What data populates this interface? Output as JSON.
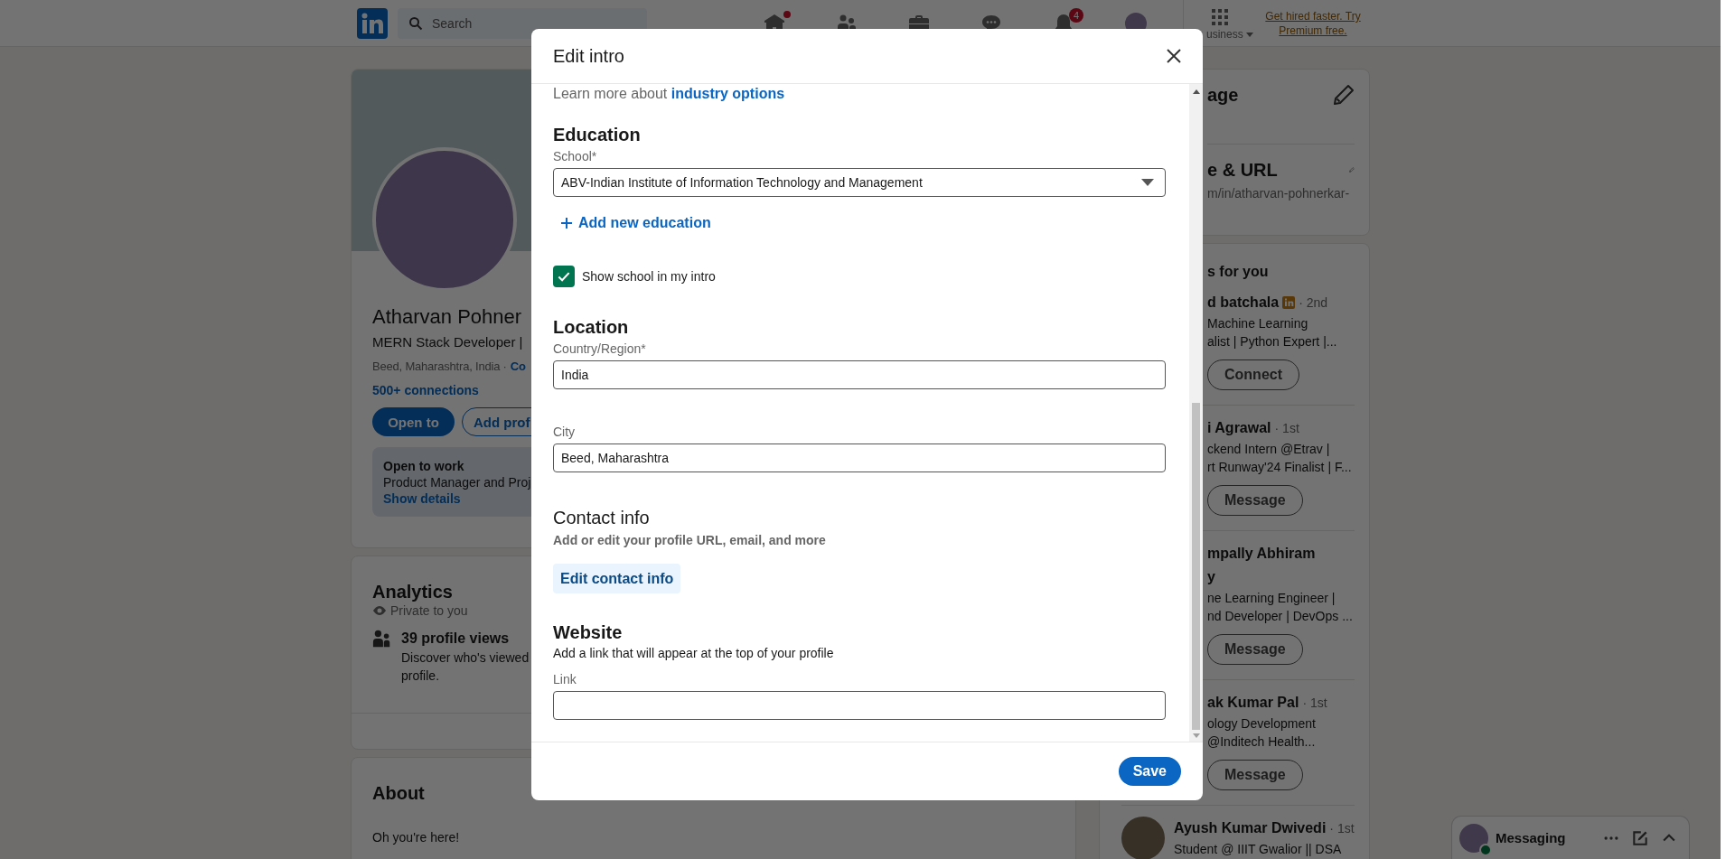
{
  "nav": {
    "search_placeholder": "Search",
    "items": [
      {
        "kind": "home",
        "dot": true
      },
      {
        "kind": "network",
        "dot": false
      },
      {
        "kind": "jobs",
        "dot": false
      },
      {
        "kind": "messaging",
        "dot": false
      },
      {
        "kind": "notifications",
        "dot": false,
        "badge": "4"
      },
      {
        "kind": "me",
        "dot": false
      }
    ],
    "business": "usiness",
    "premium": "Get hired faster. Try Premium free."
  },
  "profile": {
    "name": "Atharvan Pohner",
    "headline": "MERN Stack Developer |",
    "location": "Beed, Maharashtra, India ·",
    "contact_link": "Co",
    "connections": "500+ connections",
    "buttons": [
      {
        "label": "Open to",
        "kind": "primary"
      },
      {
        "label": "Add prof",
        "kind": "outline"
      }
    ],
    "open_to_work": {
      "title": "Open to work",
      "text": "Product Manager and Proj",
      "link": "Show details"
    }
  },
  "analytics": {
    "title": "Analytics",
    "privacy": "Private to you",
    "views": "39 profile views",
    "description_lines": [
      "Discover who's viewed",
      "profile."
    ]
  },
  "about": {
    "title": "About",
    "text": "Oh you're here!"
  },
  "right": {
    "settings": [
      {
        "title": "age"
      },
      {
        "title": "e & URL",
        "subtitle": "m/in/atharvan-pohnerkar-"
      }
    ],
    "suggestions_title": "s for you",
    "people": [
      {
        "name_lines": [
          "d batchala"
        ],
        "premium": true,
        "degree": "· 2nd",
        "lines": [
          "Machine Learning",
          "alist | Python Expert |..."
        ],
        "action": "Connect",
        "avatar": false
      },
      {
        "name_lines": [
          "i Agrawal"
        ],
        "premium": false,
        "degree": "· 1st",
        "lines": [
          "ckend Intern @Etrav |",
          "rt Runway'24 Finalist | F..."
        ],
        "action": "Message",
        "avatar": false
      },
      {
        "name_lines": [
          "mpally Abhiram",
          "y"
        ],
        "premium": false,
        "lines": [
          "ne Learning Engineer |",
          "nd Developer | DevOps ..."
        ],
        "action": "Message",
        "avatar": false
      },
      {
        "name_lines": [
          "ak Kumar Pal"
        ],
        "premium": false,
        "degree": "· 1st",
        "lines": [
          "ology Development",
          "@Inditech Health..."
        ],
        "action": "Message",
        "avatar": false
      },
      {
        "name_lines": [
          "Ayush Kumar Dwivedi"
        ],
        "premium": false,
        "degree": "· 1st",
        "lines": [
          "Student @ IIIT Gwalior || DSA"
        ],
        "avatar": true
      }
    ]
  },
  "messaging": {
    "label": "Messaging",
    "online": true
  },
  "modal": {
    "title": "Edit intro",
    "intro_text": "Learn more about",
    "intro_link": "industry options",
    "education": {
      "heading": "Education",
      "school_label": "School*",
      "school_value": "ABV-Indian Institute of Information Technology and Management",
      "add_link": "Add new education",
      "show_school": {
        "label": "Show school in my intro",
        "checked": true
      }
    },
    "location": {
      "heading": "Location",
      "country_label": "Country/Region*",
      "country_value": "India",
      "city_label": "City",
      "city_value": "Beed, Maharashtra"
    },
    "contact": {
      "heading": "Contact info",
      "description": "Add or edit your profile URL, email, and more",
      "button": "Edit contact info"
    },
    "website": {
      "heading": "Website",
      "description": "Add a link that will appear at the top of your profile",
      "link_label": "Link"
    },
    "save": "Save"
  }
}
